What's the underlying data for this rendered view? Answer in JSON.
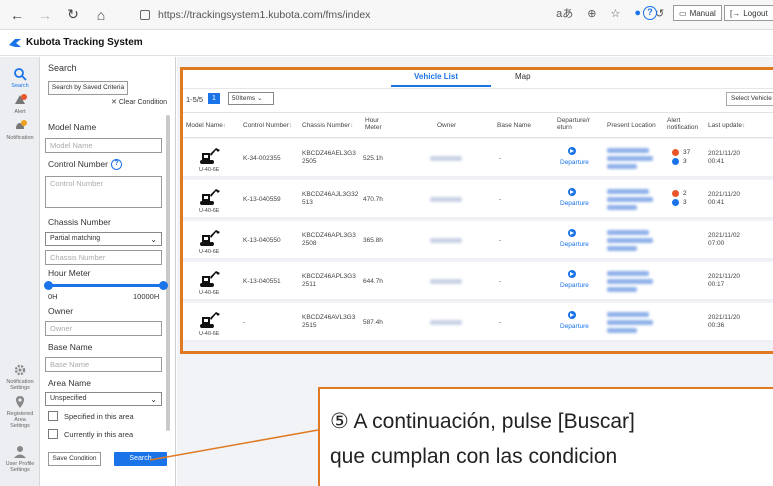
{
  "browser": {
    "url": "https://trackingsystem1.kubota.com/fms/index"
  },
  "header": {
    "app_title": "Kubota Tracking System",
    "manual_label": "Manual",
    "logout_label": "Logout"
  },
  "rail": {
    "search": "Search",
    "alert": "Alert",
    "notification": "Notification",
    "notification_settings": [
      "Notification",
      "Settings"
    ],
    "registered_area_settings": [
      "Registered",
      "Area",
      "Settings"
    ],
    "user_profile_settings": [
      "User Profile",
      "Settings"
    ]
  },
  "search_panel": {
    "title": "Search",
    "saved_criteria_label": "Search by Saved Criteria",
    "clear_condition_label": "Clear Condition",
    "model_name_label": "Model Name",
    "model_name_placeholder": "Model Name",
    "control_number_label": "Control Number",
    "control_number_placeholder": "Control Number",
    "chassis_number_label": "Chassis Number",
    "chassis_match_value": "Partial matching",
    "chassis_number_placeholder": "Chassis Number",
    "hour_meter_label": "Hour Meter",
    "hour_meter_min": "0H",
    "hour_meter_max": "10000H",
    "hour_meter_range": [
      0,
      10000
    ],
    "owner_label": "Owner",
    "owner_placeholder": "Owner",
    "base_name_label": "Base Name",
    "base_name_placeholder": "Base Name",
    "area_name_label": "Area Name",
    "area_name_value": "Unspecified",
    "specified_area_label": "Specified in this area",
    "currently_area_label": "Currently in this area",
    "save_condition_label": "Save Condition",
    "search_label": "Search"
  },
  "tabs": {
    "vehicle_list": "Vehicle List",
    "map": "Map"
  },
  "toolbar": {
    "range": "1-5/5",
    "page": "1",
    "per_page": "50Items",
    "select_vehicle": "Select Vehicle"
  },
  "table": {
    "headers": {
      "model_name": "Model Name",
      "control_number": "Control Number",
      "chassis_number": "Chassis Number",
      "hour_meter": [
        "Hour",
        "Meter"
      ],
      "owner": "Owner",
      "base_name": "Base Name",
      "departure_return": [
        "Departure/r",
        "eturn"
      ],
      "present_location": "Present Location",
      "alert_notification": [
        "Alert",
        "notification"
      ],
      "last_update": "Last update"
    },
    "rows": [
      {
        "model": "U-40-6E",
        "control": "K-34-002355",
        "chassis": [
          "KBCDZ46AEL3G3",
          "2505"
        ],
        "hour": "525.1h",
        "base": "-",
        "departure": "Departure",
        "alert_orange": "37",
        "alert_blue": "3",
        "update": [
          "2021/11/20",
          "00:41"
        ]
      },
      {
        "model": "U-40-6E",
        "control": "K-13-040559",
        "chassis": [
          "KBCDZ46AJL3G32",
          "513"
        ],
        "hour": "470.7h",
        "base": "-",
        "departure": "Departure",
        "alert_orange": "2",
        "alert_blue": "3",
        "update": [
          "2021/11/20",
          "00:41"
        ]
      },
      {
        "model": "U-40-6E",
        "control": "K-13-040550",
        "chassis": [
          "KBCDZ46APL3G3",
          "2508"
        ],
        "hour": "365.8h",
        "base": "-",
        "departure": "Departure",
        "alert_orange": "",
        "alert_blue": "",
        "update": [
          "2021/11/02",
          "07:00"
        ]
      },
      {
        "model": "U-40-6E",
        "control": "K-13-040551",
        "chassis": [
          "KBCDZ46APL3G3",
          "2511"
        ],
        "hour": "644.7h",
        "base": "-",
        "departure": "Departure",
        "alert_orange": "",
        "alert_blue": "",
        "update": [
          "2021/11/20",
          "00:17"
        ]
      },
      {
        "model": "U-40-6E",
        "control": "-",
        "chassis": [
          "KBCDZ46AVL3G3",
          "2515"
        ],
        "hour": "587.4h",
        "base": "-",
        "departure": "Departure",
        "alert_orange": "",
        "alert_blue": "",
        "update": [
          "2021/11/20",
          "00:36"
        ]
      }
    ]
  },
  "callout": {
    "line1": "⑤ A continuación, pulse [Buscar]",
    "line2": "que cumplan con las condicion"
  },
  "colors": {
    "accent": "#1a73e8",
    "highlight": "#e07a22",
    "alert": "#e8562a"
  }
}
